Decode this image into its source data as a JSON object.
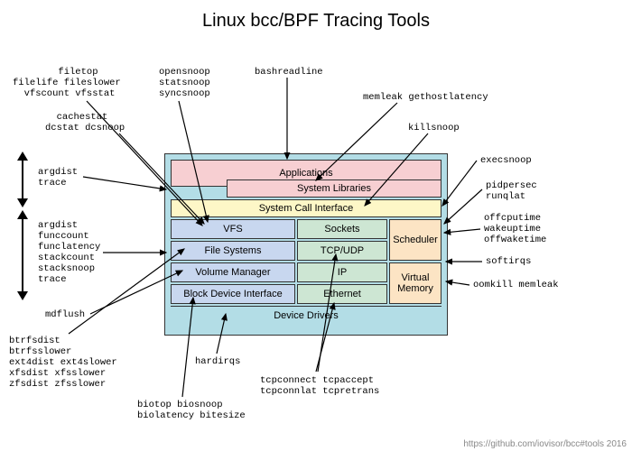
{
  "title": "Linux bcc/BPF Tracing Tools",
  "footer": "https://github.com/iovisor/bcc#tools 2016",
  "diagram": {
    "apps": "Applications",
    "syslib": "System Libraries",
    "syscall": "System Call Interface",
    "vfs": "VFS",
    "sockets": "Sockets",
    "fs": "File Systems",
    "tcpudp": "TCP/UDP",
    "volmgr": "Volume Manager",
    "ip": "IP",
    "bdi": "Block Device Interface",
    "eth": "Ethernet",
    "sched": "Scheduler",
    "vmem": "Virtual\nMemory",
    "drivers": "Device Drivers"
  },
  "labels": {
    "filetop": "        filetop\nfilelife fileslower\n  vfscount vfsstat",
    "cachestat": "  cachestat\ndcstat dcsnoop",
    "opensnoop": "opensnoop\nstatsnoop\nsyncsnoop",
    "bashreadline": "bashreadline",
    "memleak": "memleak gethostlatency",
    "killsnoop": "killsnoop",
    "execsnoop": "execsnoop",
    "pidpersec": "pidpersec\nrunqlat",
    "offcpu": "offcputime\nwakeuptime\noffwaketime",
    "softirqs": "softirqs",
    "oomkill": "oomkill memleak",
    "argdist1": "argdist\ntrace",
    "argdist2": "argdist\nfunccount\nfunclatency\nstackcount\nstacksnoop\ntrace",
    "mdflush": "mdflush",
    "btrfs": "btrfsdist\nbtrfsslower\next4dist ext4slower\nxfsdist xfsslower\nzfsdist zfsslower",
    "hardirqs": "hardirqs",
    "tcp": "tcpconnect tcpaccept\ntcpconnlat tcpretrans",
    "biotop": "biotop biosnoop\nbiolatency bitesize"
  }
}
